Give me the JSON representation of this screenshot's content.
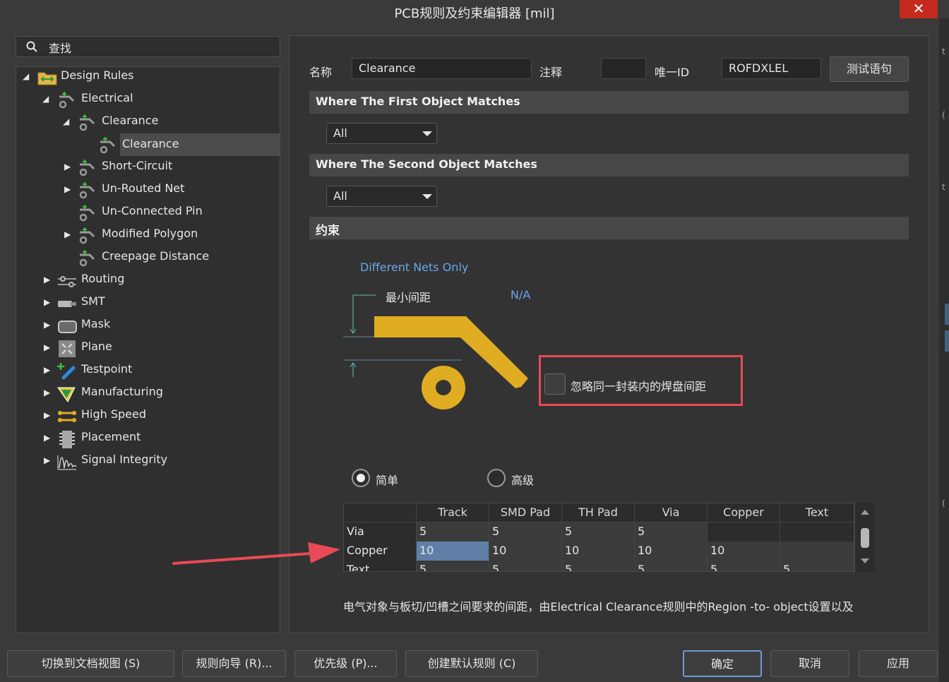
{
  "window": {
    "title": "PCB规则及约束编辑器 [mil]",
    "close": "✕"
  },
  "right_strip": {
    "glyphs": [
      "t",
      "(",
      "t",
      "("
    ]
  },
  "search": {
    "label": "查找"
  },
  "tree": {
    "design_rules": "Design Rules",
    "electrical": "Electrical",
    "clearance_group": "Clearance",
    "clearance_rule": "Clearance",
    "short_circuit": "Short-Circuit",
    "unrouted_net": "Un-Routed Net",
    "unconnected_pin": "Un-Connected Pin",
    "modified_polygon": "Modified Polygon",
    "creepage": "Creepage Distance",
    "routing": "Routing",
    "smt": "SMT",
    "mask": "Mask",
    "plane": "Plane",
    "testpoint": "Testpoint",
    "manufacturing": "Manufacturing",
    "high_speed": "High Speed",
    "placement": "Placement",
    "signal_integrity": "Signal Integrity"
  },
  "rule": {
    "name_label": "名称",
    "name_value": "Clearance",
    "comment_label": "注释",
    "comment_value": "",
    "uid_label": "唯一ID",
    "uid_value": "ROFDXLEL",
    "test_button": "测试语句"
  },
  "first_match": {
    "title": "Where The First Object Matches",
    "value": "All"
  },
  "second_match": {
    "title": "Where The Second Object Matches",
    "value": "All"
  },
  "constraints": {
    "title": "约束",
    "diff_nets": "Different Nets Only",
    "min_clearance": "最小间距",
    "na": "N/A",
    "ignore_pad": "忽略同一封装内的焊盘间距",
    "simple": "简单",
    "advanced": "高级"
  },
  "grid": {
    "headers": [
      "Track",
      "SMD Pad",
      "TH Pad",
      "Via",
      "Copper",
      "Text"
    ],
    "rows": [
      {
        "label": "Via",
        "cells": [
          "5",
          "5",
          "5",
          "5",
          "",
          ""
        ]
      },
      {
        "label": "Copper",
        "cells": [
          "10",
          "10",
          "10",
          "10",
          "10",
          ""
        ]
      },
      {
        "label": "Text",
        "cells": [
          "5",
          "5",
          "5",
          "5",
          "5",
          "5"
        ]
      }
    ]
  },
  "note": "电气对象与板切/凹槽之间要求的间距，由Electrical Clearance规则中的Region -to- object设置以及",
  "footer": {
    "doc_view": "切换到文档视图 (S)",
    "wizard": "规则向导 (R)...",
    "priority": "优先级 (P)...",
    "create_default": "创建默认规则 (C)",
    "ok": "确定",
    "cancel": "取消",
    "apply": "应用"
  },
  "colors": {
    "accent": "#6aa6e8",
    "highlight": "#e94a55",
    "copper": "#e0ac22",
    "selection": "#5f7fa8"
  }
}
